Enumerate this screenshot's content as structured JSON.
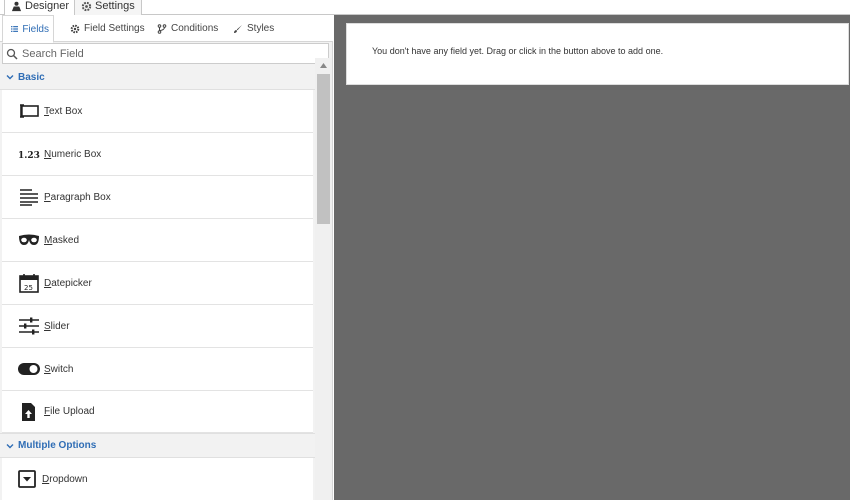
{
  "top_tabs": [
    {
      "label": "Designer",
      "icon": "designer-icon",
      "active": true
    },
    {
      "label": "Settings",
      "icon": "gear-icon",
      "active": false
    }
  ],
  "sub_tabs": [
    {
      "label": "Fields",
      "icon": "list-icon",
      "active": true
    },
    {
      "label": "Field Settings",
      "icon": "gear-icon",
      "active": false
    },
    {
      "label": "Conditions",
      "icon": "branch-icon",
      "active": false
    },
    {
      "label": "Styles",
      "icon": "brush-icon",
      "active": false
    }
  ],
  "search": {
    "placeholder": "Search Field"
  },
  "groups": [
    {
      "label": "Basic",
      "items": [
        {
          "label": "Text Box",
          "icon": "textbox-icon"
        },
        {
          "label": "Numeric Box",
          "icon": "numeric-icon"
        },
        {
          "label": "Paragraph Box",
          "icon": "paragraph-icon"
        },
        {
          "label": "Masked",
          "icon": "mask-icon"
        },
        {
          "label": "Datepicker",
          "icon": "calendar-icon"
        },
        {
          "label": "Slider",
          "icon": "slider-icon"
        },
        {
          "label": "Switch",
          "icon": "switch-icon"
        },
        {
          "label": "File Upload",
          "icon": "file-upload-icon"
        }
      ]
    },
    {
      "label": "Multiple Options",
      "items": [
        {
          "label": "Dropdown",
          "icon": "dropdown-icon"
        }
      ]
    }
  ],
  "canvas": {
    "empty_message": "You don't have any field yet. Drag or click in the button above to add one."
  },
  "colors": {
    "accent": "#2f6db5",
    "canvas_bg": "#696969"
  }
}
